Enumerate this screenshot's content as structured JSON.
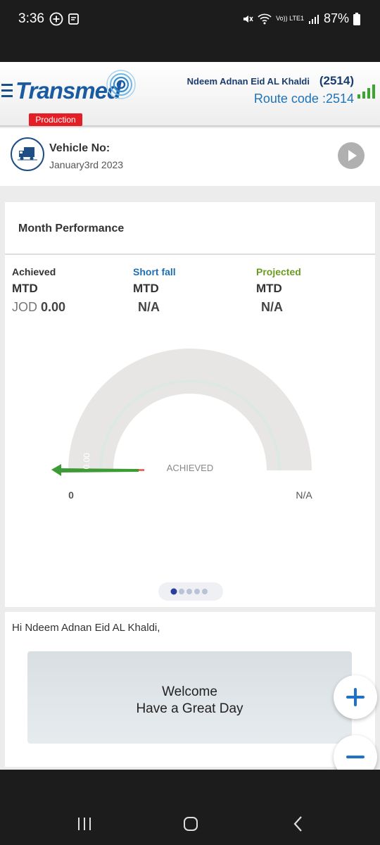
{
  "status_bar": {
    "time": "3:36",
    "left_icons": [
      "add-circle-icon",
      "note-icon"
    ],
    "right_icons": [
      "mute-icon",
      "wifi-icon",
      "signal-icon",
      "battery-icon"
    ],
    "network": "Vo)) LTE1",
    "battery": "87%"
  },
  "header": {
    "logo_text": "Transmed",
    "environment_badge": "Production",
    "user_name": "Ndeem Adnan Eid AL Khaldi",
    "user_code": "(2514)",
    "route_code": "Route code :2514",
    "brand_color": "#1a5aa0",
    "badge_color": "#e41e26"
  },
  "vehicle": {
    "label": "Vehicle No:",
    "date": "January3rd 2023"
  },
  "performance": {
    "title": "Month Performance",
    "columns": [
      {
        "label": "Achieved",
        "period": "MTD",
        "currency": "JOD",
        "value": "0.00",
        "color": "#333333"
      },
      {
        "label": "Short fall",
        "period": "MTD",
        "currency": "",
        "value": "N/A",
        "color": "#1e6fb3"
      },
      {
        "label": "Projected",
        "period": "MTD",
        "currency": "",
        "value": "N/A",
        "color": "#6a9a1f"
      }
    ],
    "gauge": {
      "center_label": "ACHIEVED",
      "min_label": "0",
      "max_label": "N/A",
      "needle_label": "0.00",
      "needle_color": "#3d9b35"
    },
    "pager": {
      "count": 5,
      "active": 0
    }
  },
  "greeting": {
    "text": "Hi Ndeem Adnan Eid AL Khaldi,",
    "welcome_line1": "Welcome",
    "welcome_line2": "Have a Great Day"
  },
  "fabs": {
    "zoom_in_color": "#1e73c9",
    "zoom_out_color": "#1e73c9"
  }
}
